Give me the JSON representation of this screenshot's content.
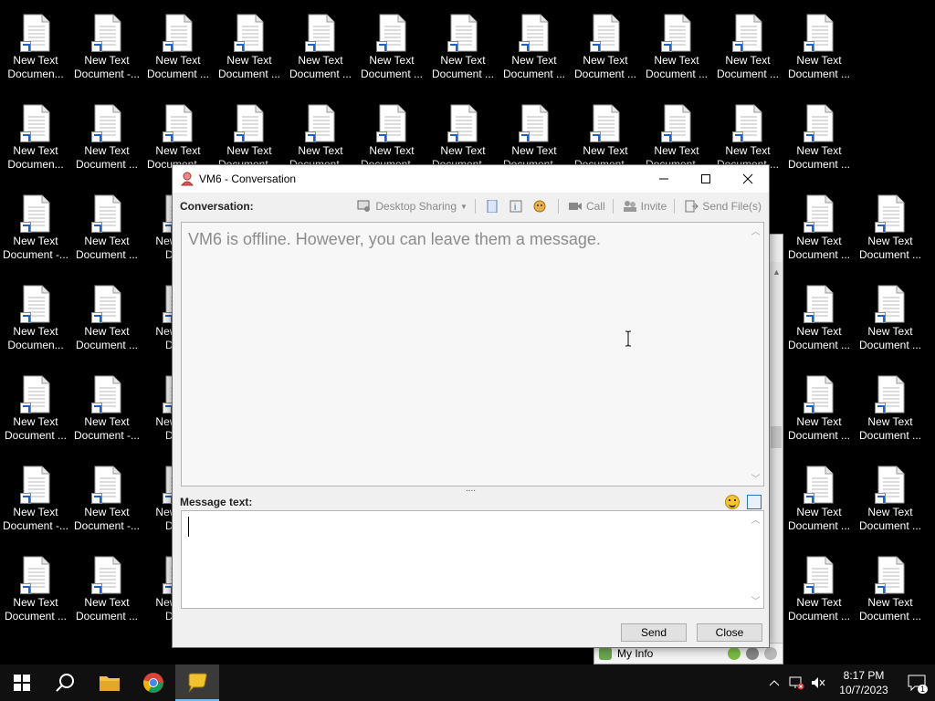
{
  "desktop": {
    "icons": [
      "New Text Documen...",
      "New Text Document -...",
      "New Text Document ...",
      "New Text Document ...",
      "New Text Document ...",
      "New Text Document ...",
      "New Text Document ...",
      "New Text Document ...",
      "New Text Document ...",
      "New Text Document ...",
      "New Text Document ...",
      "New Text Document ...",
      "New Text Documen...",
      "New Text Document ...",
      "New Text Document ...",
      "New Text Document ...",
      "New Text Document ...",
      "New Text Document ...",
      "New Text Document ...",
      "New Text Document ...",
      "New Text Document ...",
      "New Text Document ...",
      "New Text Document ...",
      "New Text Document ...",
      "New Text Document -...",
      "New Text Document ...",
      "New Text Docu",
      "New Text Document ...",
      "New Text Document ...",
      "New Text Documen...",
      "New Text Document ...",
      "New Text Docu",
      "New Text Document ...",
      "New Text Document ...",
      "New Text Document ...",
      "New Text Document -...",
      "New Text Docu",
      "New Text Document ...",
      "New Text Document ...",
      "New Text Document -...",
      "New Text Document -...",
      "New Text Docu",
      "New Text Document ...",
      "New Text Document ...",
      "New Text Document ...",
      "New Text Document ...",
      "New Text Docu",
      "New Text Document ...",
      "New Text Document ..."
    ],
    "icon_line1": "New Text",
    "labels_line2": {
      "r0": [
        "Documen...",
        "Document -...",
        "Document ...",
        "Document ...",
        "Document ...",
        "Document ...",
        "Document ...",
        "Document ...",
        "Document ...",
        "Document ...",
        "Document ...",
        "Document ..."
      ],
      "r1": [
        "Documen...",
        "Document ...",
        "Document ...",
        "Document ...",
        "Document ...",
        "Document ...",
        "Document ...",
        "Document ...",
        "Document ...",
        "Document ...",
        "Document ...",
        "Document ..."
      ],
      "left": [
        [
          "Document -...",
          "Document ...",
          "Docu"
        ],
        [
          "Documen...",
          "Document ...",
          "Docu"
        ],
        [
          "Document ...",
          "Document -...",
          "Docu"
        ],
        [
          "Document -...",
          "Document -...",
          "Docu"
        ],
        [
          "Document ...",
          "Document ...",
          "Docu"
        ]
      ],
      "right": [
        [
          "Document ...",
          "Document ..."
        ],
        [
          "Document ...",
          "Document ..."
        ],
        [
          "Document ...",
          "Document ..."
        ],
        [
          "Document ...",
          "Document ..."
        ],
        [
          "Document ...",
          "Document ..."
        ]
      ]
    }
  },
  "background_window": {
    "my_info_label": "My Info"
  },
  "dialog": {
    "title": "VM6 - Conversation",
    "conversation_label": "Conversation:",
    "toolbar": {
      "desktop_sharing": "Desktop Sharing",
      "call": "Call",
      "invite": "Invite",
      "send_files": "Send File(s)"
    },
    "offline_message": "VM6 is offline. However, you can leave them a message.",
    "splitter_glyph": "....",
    "message_label": "Message text:",
    "message_value": "",
    "send_label": "Send",
    "close_label": "Close"
  },
  "taskbar": {
    "time": "8:17 PM",
    "date": "10/7/2023",
    "notification_count": "1"
  },
  "colors": {
    "taskbar_bg": "#101010",
    "accent": "#76b9ed",
    "offline_text": "#8c8c8c"
  }
}
